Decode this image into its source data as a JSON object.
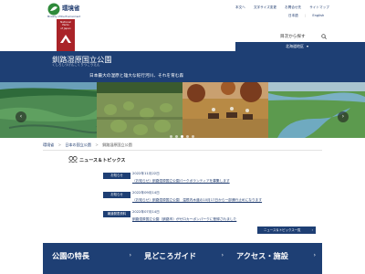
{
  "header": {
    "ministry_name": "環境省",
    "ministry_en": "Ministry of the Environment",
    "emblem_lines": [
      "National",
      "Parks",
      "of Japan"
    ],
    "util_links": [
      "本文へ",
      "文字サイズ変更",
      "お問合せ先",
      "サイトマップ"
    ],
    "lang_links": [
      "日本語",
      "English"
    ],
    "search_label": "目次から探す",
    "region_label": "北海道地区",
    "colors": {
      "navy": "#1e3f74",
      "emblem_red": "#a92328"
    }
  },
  "park": {
    "title": "釧路湿原国立公園",
    "reading": "くしろしつげんこくりつこうえん",
    "catchphrase": "日本最大の湿原と雄大な蛇行河川、それを育む森"
  },
  "slider": {
    "prev_icon": "chevron-left-icon",
    "next_icon": "chevron-right-icon",
    "slides": [
      "wetland-aerial",
      "marsh-tussock",
      "horse-riding-autumn",
      "winding-river"
    ],
    "dot_count": 5
  },
  "breadcrumb": {
    "items": [
      "環境省",
      "日本の国立公園",
      "釧路湿原国立公園"
    ]
  },
  "news": {
    "heading": "ニュース＆トピックス",
    "items": [
      {
        "tag": "お知らせ",
        "date": "2022年11月22日",
        "headline": "（お知らせ）釧路湿原国立公園パークボランティアを募集します"
      },
      {
        "tag": "お知らせ",
        "date": "2022年09月14日",
        "headline": "（お知らせ）釧路湿原国立公園　温根内木道の10月17日から一部通行止めになります"
      },
      {
        "tag": "報道発表資料",
        "date": "2022年07月14日",
        "headline": "釧路湿原国立公園（釧路市）がゼロカーボンパークに登録されました"
      }
    ],
    "more_label": "ニュース＆トピックス一覧"
  },
  "nav_tiles": [
    {
      "label": "公園の特長"
    },
    {
      "label": "見どころガイド"
    },
    {
      "label": "アクセス・施設"
    }
  ]
}
